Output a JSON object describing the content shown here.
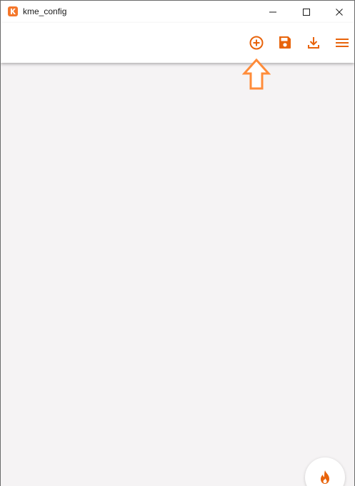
{
  "window": {
    "title": "kme_config",
    "app_icon": "kme-logo-icon",
    "controls": [
      "minimize-icon",
      "maximize-icon",
      "close-icon"
    ]
  },
  "toolbar": {
    "actions": [
      {
        "name": "add",
        "icon": "add-circle-icon"
      },
      {
        "name": "save",
        "icon": "floppy-disk-icon"
      },
      {
        "name": "download",
        "icon": "download-icon"
      },
      {
        "name": "menu",
        "icon": "hamburger-menu-icon"
      }
    ]
  },
  "annotation": {
    "icon": "up-arrow-outline",
    "points_to": "add"
  },
  "fab": {
    "icon": "flame-icon"
  },
  "colors": {
    "accent": "#e8630a",
    "annotation": "#ff8c3a",
    "logo": "#f4772b",
    "background": "#f5f3f4",
    "appbar": "#ffffff"
  }
}
